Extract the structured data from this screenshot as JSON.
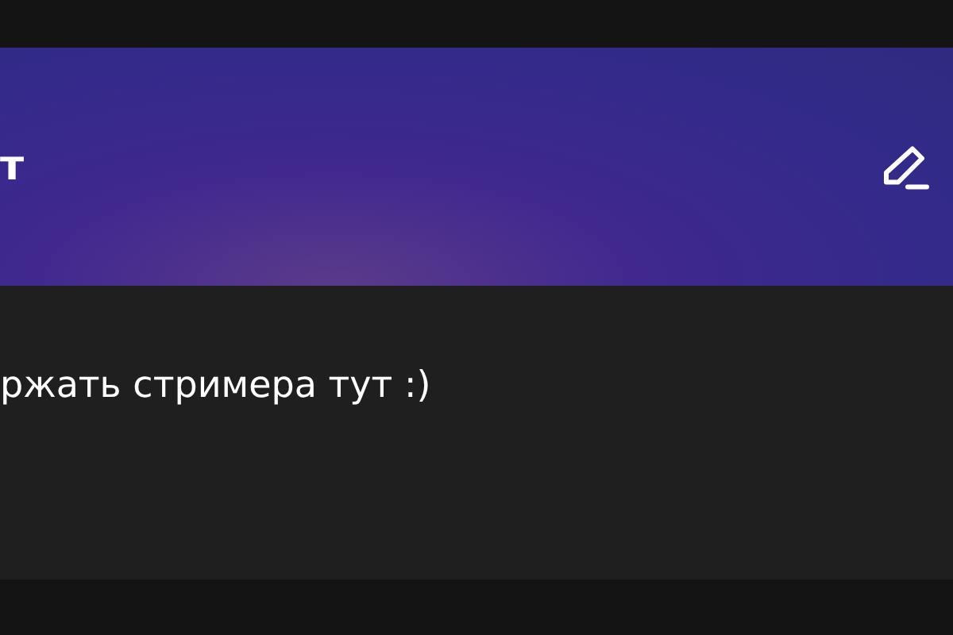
{
  "panel": {
    "title": "т",
    "description": "ржать стримера тут :)"
  }
}
